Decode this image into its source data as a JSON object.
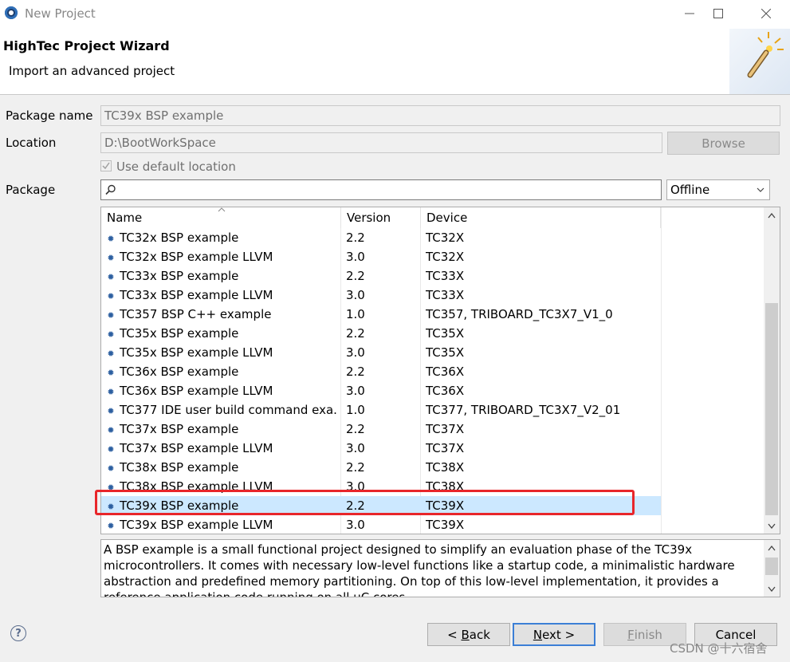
{
  "window": {
    "title": "New Project"
  },
  "header": {
    "title": "HighTec Project Wizard",
    "subtitle": "Import an advanced project"
  },
  "form": {
    "package_name_label": "Package name",
    "package_name_value": "TC39x BSP example",
    "location_label": "Location",
    "location_value": "D:\\BootWorkSpace",
    "browse_label": "Browse",
    "use_default_label": "Use default location",
    "package_label": "Package",
    "search_value": "",
    "source_value": "Offline"
  },
  "table": {
    "columns": [
      "Name",
      "Version",
      "Device"
    ],
    "rows": [
      {
        "name": "TC32x BSP example",
        "version": "2.2",
        "device": "TC32X"
      },
      {
        "name": "TC32x BSP example LLVM",
        "version": "3.0",
        "device": "TC32X"
      },
      {
        "name": "TC33x BSP example",
        "version": "2.2",
        "device": "TC33X"
      },
      {
        "name": "TC33x BSP example LLVM",
        "version": "3.0",
        "device": "TC33X"
      },
      {
        "name": "TC357 BSP C++ example",
        "version": "1.0",
        "device": "TC357, TRIBOARD_TC3X7_V1_0"
      },
      {
        "name": "TC35x BSP example",
        "version": "2.2",
        "device": "TC35X"
      },
      {
        "name": "TC35x BSP example LLVM",
        "version": "3.0",
        "device": "TC35X"
      },
      {
        "name": "TC36x BSP example",
        "version": "2.2",
        "device": "TC36X"
      },
      {
        "name": "TC36x BSP example LLVM",
        "version": "3.0",
        "device": "TC36X"
      },
      {
        "name": "TC377 IDE user build command exa...",
        "version": "1.0",
        "device": "TC377, TRIBOARD_TC3X7_V2_01"
      },
      {
        "name": "TC37x BSP example",
        "version": "2.2",
        "device": "TC37X"
      },
      {
        "name": "TC37x BSP example LLVM",
        "version": "3.0",
        "device": "TC37X"
      },
      {
        "name": "TC38x BSP example",
        "version": "2.2",
        "device": "TC38X"
      },
      {
        "name": "TC38x BSP example LLVM",
        "version": "3.0",
        "device": "TC38X"
      },
      {
        "name": "TC39x BSP example",
        "version": "2.2",
        "device": "TC39X",
        "selected": true
      },
      {
        "name": "TC39x BSP example LLVM",
        "version": "3.0",
        "device": "TC39X"
      }
    ]
  },
  "description": "A BSP example is a small functional project designed to simplify an evaluation phase of the TC39x microcontrollers. It comes with necessary low-level functions like a startup code, a minimalistic hardware abstraction and predefined memory partitioning. On top of this low-level implementation, it provides a reference application code running on all uC cores.",
  "buttons": {
    "back_mnemonic": "< ",
    "back_underlined": "B",
    "back_rest": "ack",
    "next_underlined": "N",
    "next_rest": "ext >",
    "finish_underlined": "F",
    "finish_rest": "inish",
    "cancel": "Cancel"
  },
  "watermark": "CSDN @十六宿舍",
  "icons": {
    "app": "eclipse-icon",
    "minimize": "minimize-icon",
    "maximize": "maximize-icon",
    "close": "close-icon",
    "wizard": "magic-wand-icon",
    "search": "search-icon",
    "dropdown": "chevron-down-icon",
    "row": "package-gear-icon",
    "help": "help-icon"
  },
  "colors": {
    "selection": "#cce8ff",
    "highlight_box": "#e8262a"
  }
}
